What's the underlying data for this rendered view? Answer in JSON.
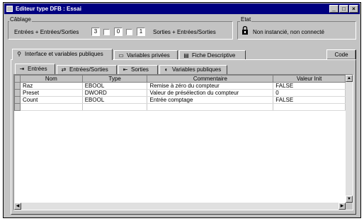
{
  "window": {
    "title": "Editeur type DFB : Essai",
    "btn_min": "_",
    "btn_max": "□",
    "btn_close": "×"
  },
  "cablage": {
    "label": "Câblage",
    "inputs_label": "Entrées + Entrées/Sorties",
    "d1": "3",
    "d2": "0",
    "d3": "1",
    "outputs_label": "Sorties + Entrées/Sorties"
  },
  "etat": {
    "label": "Etat",
    "status_text": "Non instancié, non connecté"
  },
  "main_tabs": [
    {
      "label": "Interface et variables publiques"
    },
    {
      "label": "Variables privées"
    },
    {
      "label": "Fiche Descriptive"
    }
  ],
  "code_button": "Code",
  "sub_tabs": [
    {
      "label": "Entrées"
    },
    {
      "label": "Entrées/Sorties"
    },
    {
      "label": "Sorties"
    },
    {
      "label": "Variables publiques"
    }
  ],
  "table": {
    "headers": [
      "Nom",
      "Type",
      "Commentaire",
      "Valeur Init"
    ],
    "rows": [
      {
        "nom": "Raz",
        "type": "EBOOL",
        "commentaire": "Remise à zéro du compteur",
        "valeur": "FALSE"
      },
      {
        "nom": "Preset",
        "type": "DWORD",
        "commentaire": "Valeur de présélection du compteur",
        "valeur": "0"
      },
      {
        "nom": "Count",
        "type": "EBOOL",
        "commentaire": "Entrée comptage",
        "valeur": "FALSE"
      }
    ]
  },
  "icons": {
    "window": "window-icon",
    "lock": "lock-icon",
    "interface": "interface-icon",
    "variables": "variables-icon",
    "sheet": "sheet-icon",
    "inputs": "inputs-icon",
    "inout": "inout-icon",
    "outputs": "outputs-icon",
    "public": "public-icon"
  }
}
